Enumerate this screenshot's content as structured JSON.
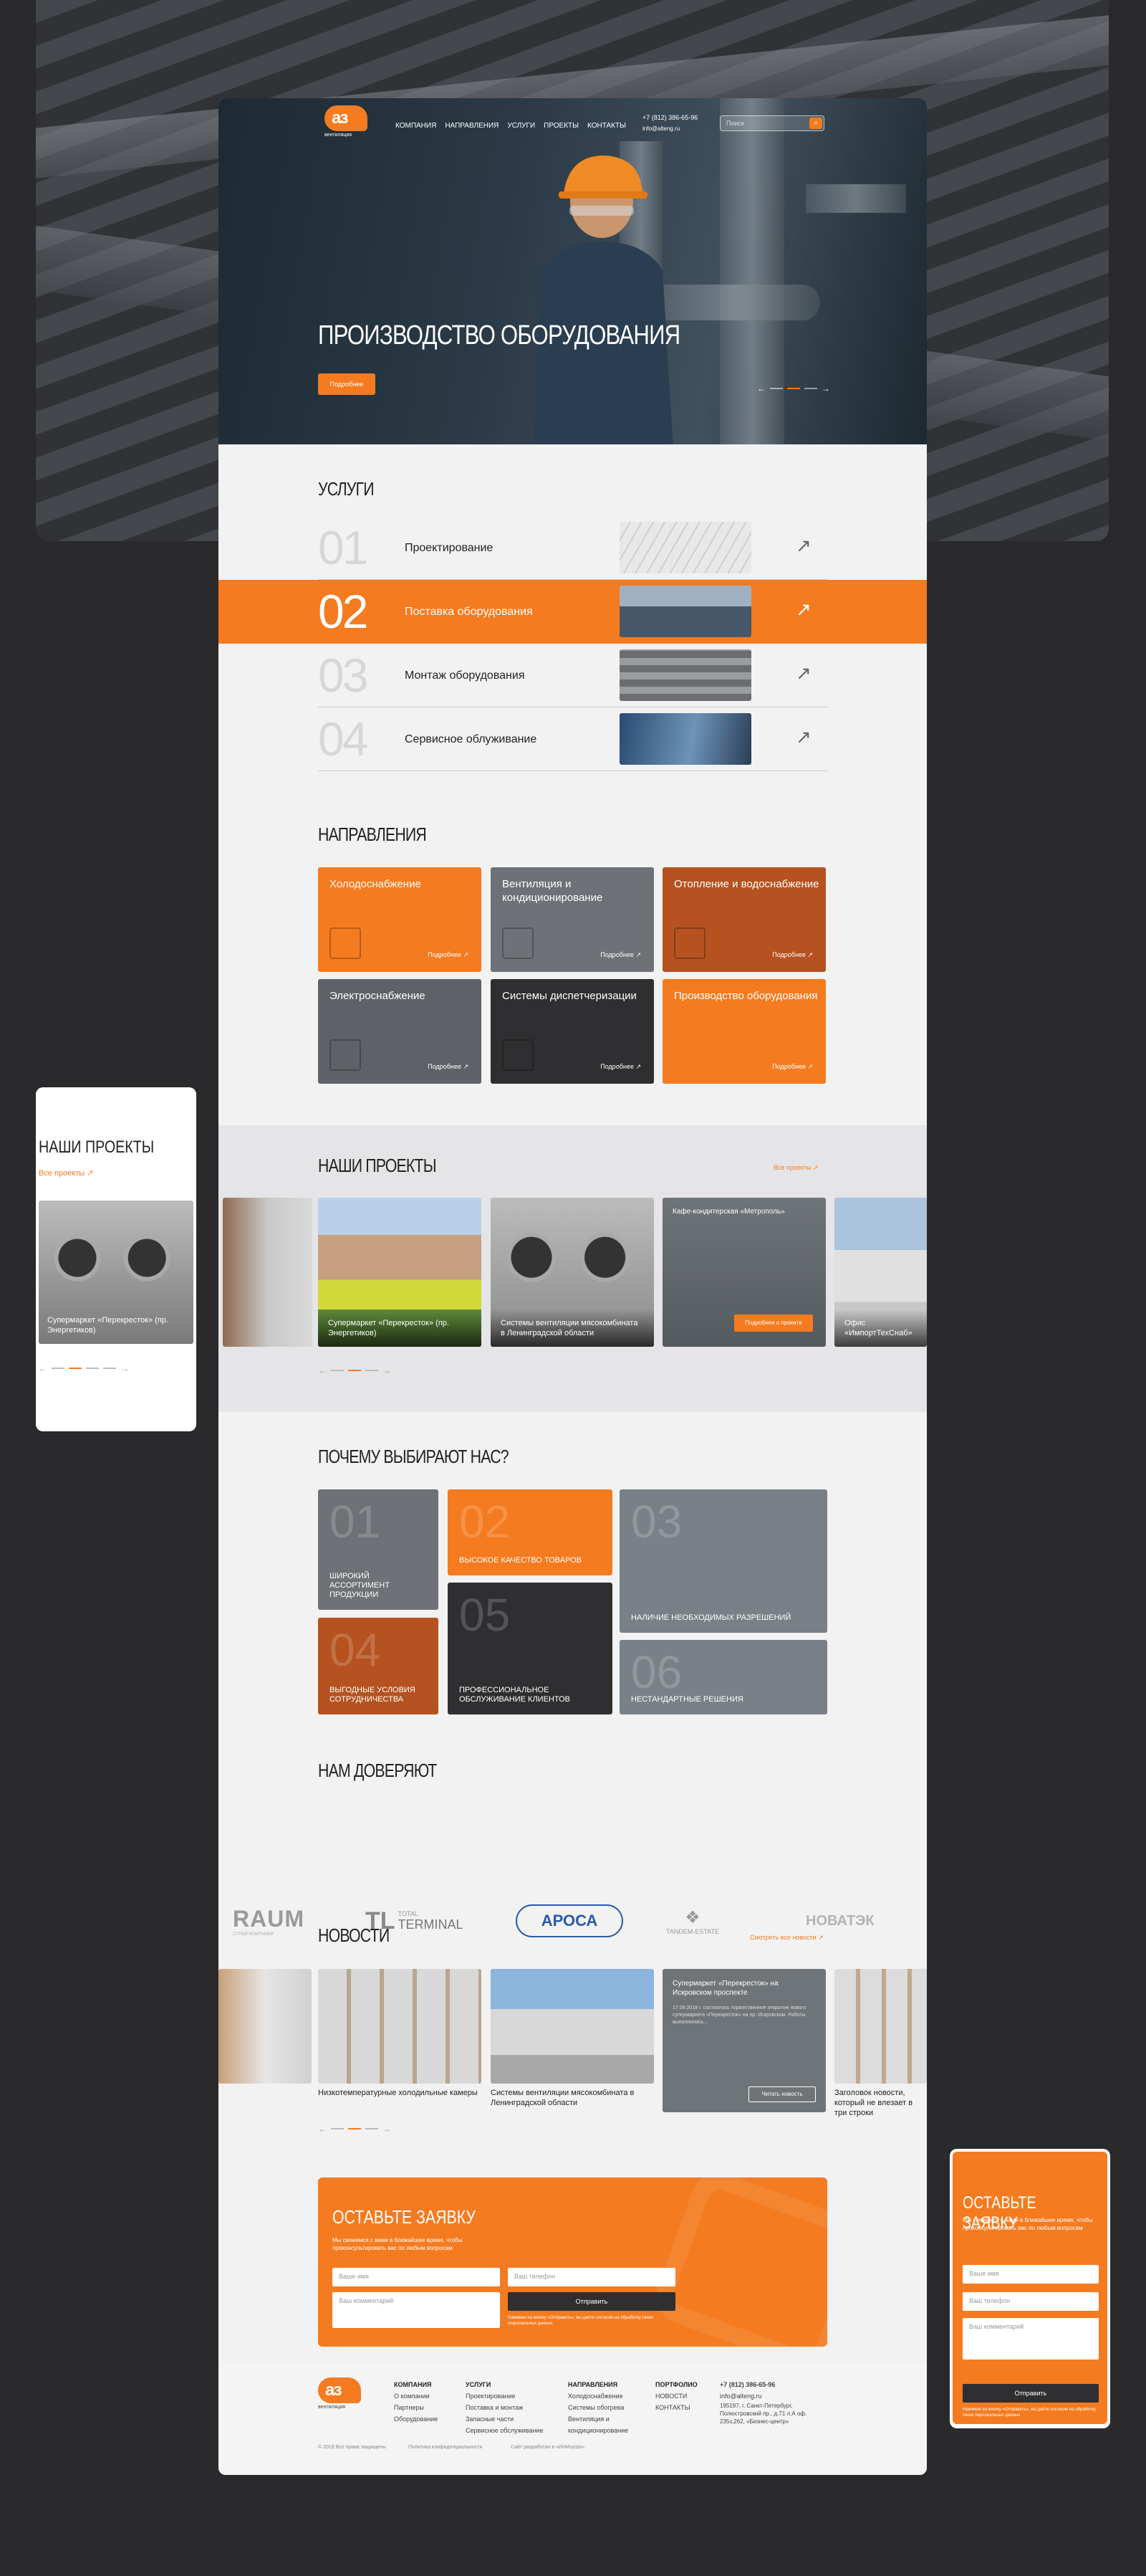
{
  "header": {
    "logo_letters": "аз",
    "logo_sub": "вентиляция",
    "nav": [
      "КОМПАНИЯ",
      "НАПРАВЛЕНИЯ",
      "УСЛУГИ",
      "ПРОЕКТЫ",
      "КОНТАКТЫ"
    ],
    "phone": "+7 (812) 386-65-96",
    "email": "info@alteng.ru",
    "search_placeholder": "Поиск"
  },
  "hero": {
    "title": "ПРОИЗВОДСТВО ОБОРУДОВАНИЯ",
    "button": "Подробнее",
    "prev": "←",
    "next": "→"
  },
  "services": {
    "title": "УСЛУГИ",
    "items": [
      {
        "num": "01",
        "label": "Проектирование"
      },
      {
        "num": "02",
        "label": "Поставка оборудования"
      },
      {
        "num": "03",
        "label": "Монтаж оборудования"
      },
      {
        "num": "04",
        "label": "Сервисное облуживание"
      }
    ],
    "arrow": "↗"
  },
  "directions": {
    "title": "НАПРАВЛЕНИЯ",
    "more": "Подробнее ↗",
    "items": [
      {
        "title": "Холодоснабжение",
        "color": "#f47b20"
      },
      {
        "title": "Вентиляция и кондиционирование",
        "color": "#6e7276"
      },
      {
        "title": "Отопление и водоснабжение",
        "color": "#b5521f"
      },
      {
        "title": "Электроснабжение",
        "color": "#5e6266"
      },
      {
        "title": "Системы диспетчеризации",
        "color": "#2f2f31"
      },
      {
        "title": "Производство оборудования",
        "color": "#f47b20"
      }
    ]
  },
  "projects": {
    "title": "НАШИ ПРОЕКТЫ",
    "all": "Все проекты ↗",
    "items": [
      {
        "caption": "Супермаркет «Перекресток» (пр. Энергетиков)"
      },
      {
        "caption": "Системы вентиляции мясокомбината в Ленинградской области"
      },
      {
        "caption": "Кафе-кондитерская «Метрополь»",
        "button": "Подробнее о проекте"
      },
      {
        "caption": "Офис «ИмпортТехСнаб»"
      }
    ],
    "prev": "←",
    "next": "→"
  },
  "why": {
    "title": "ПОЧЕМУ ВЫБИРАЮТ НАС?",
    "items": [
      {
        "num": "01",
        "text": "ШИРОКИЙ АССОРТИМЕНТ ПРОДУКЦИИ",
        "color": "#6e7276"
      },
      {
        "num": "02",
        "text": "ВЫСОКОЕ КАЧЕСТВО ТОВАРОВ",
        "color": "#f47b20"
      },
      {
        "num": "03",
        "text": "НАЛИЧИЕ НЕОБХОДИМЫХ РАЗРЕШЕНИЙ",
        "color": "#7a8088"
      },
      {
        "num": "04",
        "text": "ВЫГОДНЫЕ УСЛОВИЯ СОТРУДНИЧЕСТВА",
        "color": "#b5521f"
      },
      {
        "num": "05",
        "text": "ПРОФЕССИОНАЛЬНОЕ ОБСЛУЖИВАНИЕ КЛИЕНТОВ",
        "color": "#2f2f31"
      },
      {
        "num": "06",
        "text": "НЕСТАНДАРТНЫЕ РЕШЕНИЯ",
        "color": "#7a8088"
      }
    ]
  },
  "trust": {
    "title": "НАМ ДОВЕРЯЮТ",
    "brands": [
      {
        "name": "RAUM",
        "sub": "СТРОЙ КОМПАНИЯ"
      },
      {
        "name": "TERMINAL",
        "sub": "TOTAL"
      },
      {
        "name": "АРОСА"
      },
      {
        "name": "TANDEM-ESTATE"
      },
      {
        "name": "НОВАТЭК"
      }
    ]
  },
  "news": {
    "title": "НОВОСТИ",
    "all": "Смотреть все новости ↗",
    "items": [
      {
        "title": "Низкотемпературные холодильные камеры"
      },
      {
        "title": "Системы вентиляции мясокомбината в Ленинградской области"
      },
      {
        "title": "Супермаркет «Перекресток» на Искровском проспекте",
        "text": "17.09.2018 г. состоялось торжественное открытие нового супермаркета «Перекресток» на пр. Искровском. Работы выполнялись...",
        "button": "Читать новость"
      },
      {
        "title": "Заголовок новости, который не влезает в три строки"
      }
    ]
  },
  "form": {
    "title": "ОСТАВЬТЕ ЗАЯВКУ",
    "text": "Мы свяжемся с вами в ближайшее время, чтобы проконсультировать вас по любым вопросам",
    "name": "Ваше имя",
    "phone": "Ваш телефон",
    "comment": "Ваш комментарий",
    "submit": "Отправить",
    "agree": "Нажимая на кнопку «Отправить», вы даёте согласие на обработку своих персональных данных"
  },
  "footer": {
    "cols": [
      {
        "title": "КОМПАНИЯ",
        "items": [
          "О компании",
          "Партнеры",
          "Оборудование"
        ]
      },
      {
        "title": "УСЛУГИ",
        "items": [
          "Проектирование",
          "Поставка и монтаж",
          "Запасные части",
          "Сервисное обслуживание"
        ]
      },
      {
        "title": "НАПРАВЛЕНИЯ",
        "items": [
          "Холодоснабжение",
          "Системы обогрева",
          "Вентиляция и кондиционирование"
        ]
      },
      {
        "title": "ПОРТФОЛИО",
        "items": [
          "НОВОСТИ",
          "КОНТАКТЫ"
        ]
      }
    ],
    "phone": "+7 (812) 386-65-96",
    "email": "info@alteng.ru",
    "address": "195197, г. Санкт-Петербург, Полюстровский пр., д.71 л.А оф. 235з,262, «Бизнес-центр»",
    "copyright": "© 2019 Все права защищены",
    "policy": "Политика конфиденциальности",
    "dev": "Сайт разработан в «ИнМоуШн»"
  },
  "mobile_left": {
    "title": "НАШИ ПРОЕКТЫ",
    "all": "Все проекты ↗",
    "caption": "Супермаркет «Перекресток» (пр. Энергетиков)"
  },
  "mobile_right": {
    "title": "ОСТАВЬТЕ ЗАЯВКУ",
    "text": "Мы свяжемся с вами в ближайшее время, чтобы проконсультировать вас по любым вопросам",
    "name": "Ваше имя",
    "phone": "Ваш телефон",
    "comment": "Ваш комментарий",
    "submit": "Отправить",
    "agree": "Нажимая на кнопку «Отправить», вы даёте согласие на обработку своих персональных данных"
  }
}
